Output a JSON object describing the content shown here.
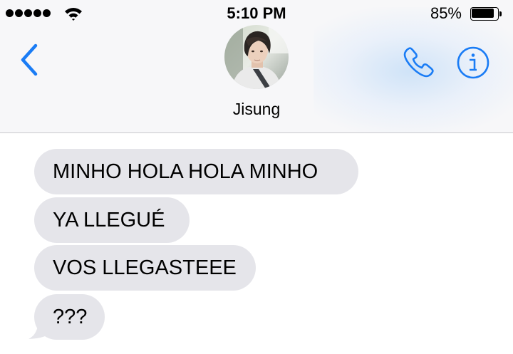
{
  "status_bar": {
    "time": "5:10 PM",
    "battery_percent": "85%",
    "battery_level": 0.85,
    "signal_bars": 5
  },
  "nav": {
    "back_icon": "chevron-left-icon",
    "contact_name": "Jisung",
    "call_icon": "phone-icon",
    "info_icon": "info-icon"
  },
  "messages": [
    {
      "text": " MINHO HOLA HOLA MINHO",
      "direction": "received"
    },
    {
      "text": "YA LLEGUÉ",
      "direction": "received"
    },
    {
      "text": "VOS LLEGASTEEE",
      "direction": "received"
    },
    {
      "text": "???",
      "direction": "received"
    }
  ],
  "colors": {
    "accent": "#1a7cf5",
    "received_bubble": "#e5e5ea",
    "header_bg": "#f7f7f9"
  }
}
